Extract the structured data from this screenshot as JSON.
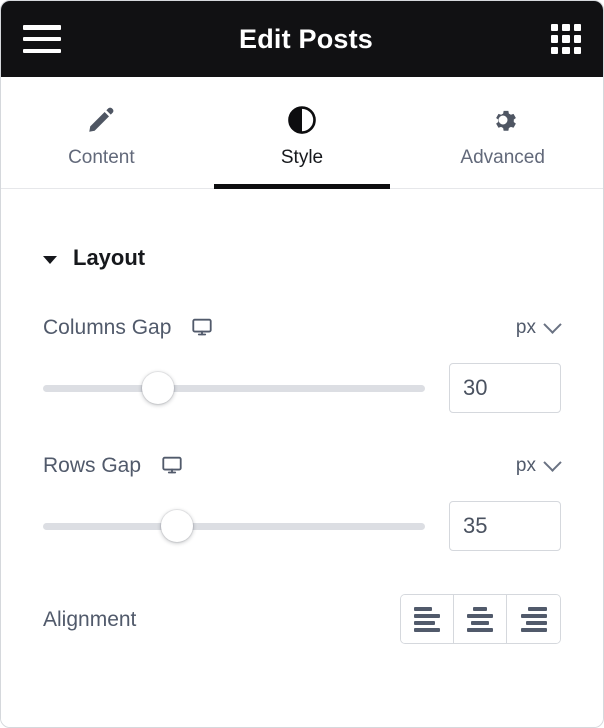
{
  "header": {
    "title": "Edit Posts",
    "menu_icon": "hamburger-menu-icon",
    "apps_icon": "grid-apps-icon"
  },
  "tabs": [
    {
      "label": "Content",
      "icon": "pencil-icon",
      "active": false
    },
    {
      "label": "Style",
      "icon": "contrast-icon",
      "active": true
    },
    {
      "label": "Advanced",
      "icon": "gear-icon",
      "active": false
    }
  ],
  "section": {
    "title": "Layout",
    "expanded": true,
    "caret_icon": "caret-down-icon"
  },
  "controls": {
    "columns_gap": {
      "label": "Columns Gap",
      "device_icon": "desktop-icon",
      "unit": "px",
      "unit_caret_icon": "chevron-down-icon",
      "value": "30",
      "slider_percent": 30
    },
    "rows_gap": {
      "label": "Rows Gap",
      "device_icon": "desktop-icon",
      "unit": "px",
      "unit_caret_icon": "chevron-down-icon",
      "value": "35",
      "slider_percent": 35
    },
    "alignment": {
      "label": "Alignment",
      "options": [
        {
          "name": "align-left",
          "icon": "align-left-icon"
        },
        {
          "name": "align-center",
          "icon": "align-center-icon"
        },
        {
          "name": "align-right",
          "icon": "align-right-icon"
        }
      ]
    }
  },
  "colors": {
    "header_bg": "#111113",
    "accent": "#0d0d0f",
    "label_text": "#515a6b",
    "track": "#dcdee3",
    "border": "#d5d8dd"
  }
}
